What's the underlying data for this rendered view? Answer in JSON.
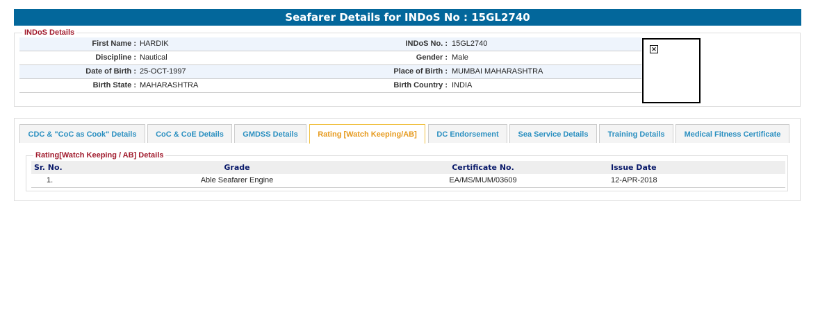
{
  "title": "Seafarer Details for INDoS No : 15GL2740",
  "indos": {
    "legend": "INDoS Details",
    "rows": [
      {
        "l1": "First Name :",
        "v1": "HARDIK",
        "l2": "INDoS No. :",
        "v2": "15GL2740"
      },
      {
        "l1": "Discipline :",
        "v1": "Nautical",
        "l2": "Gender :",
        "v2": "Male"
      },
      {
        "l1": "Date of Birth :",
        "v1": "25-OCT-1997",
        "l2": "Place of Birth :",
        "v2": "MUMBAI MAHARASHTRA"
      },
      {
        "l1": "Birth State :",
        "v1": "MAHARASHTRA",
        "l2": "Birth Country :",
        "v2": "INDIA"
      }
    ],
    "photo_icon": "broken-image-icon"
  },
  "tabs": [
    "CDC & \"CoC as Cook\" Details",
    "CoC & CoE Details",
    "GMDSS Details",
    "Rating [Watch Keeping/AB]",
    "DC Endorsement",
    "Sea Service Details",
    "Training Details",
    "Medical Fitness Certificate"
  ],
  "active_tab": 3,
  "rating": {
    "legend": "Rating[Watch Keeping / AB] Details",
    "headers": [
      "Sr. No.",
      "Grade",
      "Certificate No.",
      "Issue Date"
    ],
    "rows": [
      [
        "1.",
        "Able Seafarer Engine",
        "EA/MS/MUM/03609",
        "12-APR-2018"
      ]
    ]
  },
  "colors": {
    "header": "#03679b",
    "legend": "#a0192b",
    "tab": "#2a8fc0",
    "active_tab": "#e69a1e"
  }
}
